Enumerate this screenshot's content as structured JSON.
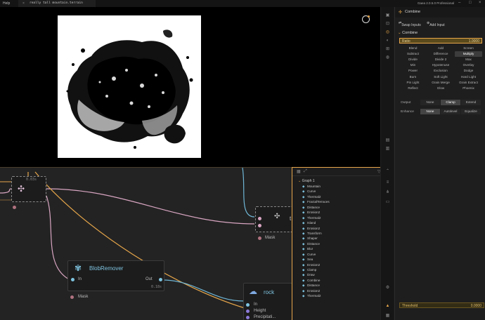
{
  "topbar": {
    "help": "Help",
    "file_close": "×",
    "file_name": "really tall mountain.terrain",
    "product": "Gaea 2.0.5.0 Professional",
    "minimize": "–",
    "maximize": "□",
    "close": "×"
  },
  "colors": {
    "accent": "#e6a64a",
    "node_title": "#7fc4e0",
    "wire_pink": "#d9a6c2",
    "wire_orange": "#e6a64a",
    "wire_blue": "#6fb6d6"
  },
  "graph": {
    "top_node": {
      "timing": "0.03s"
    },
    "blob": {
      "title": "BlobRemover",
      "in": "In",
      "out": "Out",
      "timing": "0.18s",
      "mask": "Mask"
    },
    "right_node": {
      "title": "t",
      "mask": "Mask"
    },
    "rock": {
      "title": "rock",
      "in": "In",
      "height": "Height",
      "precip": "Precipitati..."
    }
  },
  "nodelist": {
    "root": "Graph 1",
    "items": [
      {
        "name": "Mountain",
        "icon": "mountain-icon"
      },
      {
        "name": "Curve",
        "icon": "curve-icon"
      },
      {
        "name": "Thermal2",
        "icon": "thermal-icon"
      },
      {
        "name": "FractalTerraces",
        "icon": "terraces-icon"
      },
      {
        "name": "Distance",
        "icon": "distance-icon"
      },
      {
        "name": "Erosion2",
        "icon": "erosion-icon"
      },
      {
        "name": "Thermal2",
        "icon": "thermal-icon"
      },
      {
        "name": "Island",
        "icon": "island-icon"
      },
      {
        "name": "Erosion2",
        "icon": "erosion-icon"
      },
      {
        "name": "Transform",
        "icon": "transform-icon"
      },
      {
        "name": "Shaper",
        "icon": "shaper-icon"
      },
      {
        "name": "Distance",
        "icon": "distance-icon"
      },
      {
        "name": "Blur",
        "icon": "blur-icon"
      },
      {
        "name": "Curve",
        "icon": "curve-icon"
      },
      {
        "name": "Sea",
        "icon": "sea-icon"
      },
      {
        "name": "Erosion2",
        "icon": "erosion-icon"
      },
      {
        "name": "Clamp",
        "icon": "clamp-icon"
      },
      {
        "name": "Draw",
        "icon": "draw-icon"
      },
      {
        "name": "Combine",
        "icon": "combine-icon"
      },
      {
        "name": "Distance",
        "icon": "distance-icon"
      },
      {
        "name": "Erosion2",
        "icon": "erosion-icon"
      },
      {
        "name": "Thermal2",
        "icon": "thermal-icon"
      }
    ]
  },
  "props": {
    "title": "Combine",
    "swap_inputs": "Swap Inputs",
    "add_input": "Add Input",
    "section": "Combine",
    "ratio_label": "Ratio",
    "ratio_value": "1.0000",
    "modes": [
      "Blend",
      "Add",
      "Screen",
      "Subtract",
      "Difference",
      "Multiply",
      "Divide",
      "Divide 2",
      "Max",
      "Min",
      "Hypotenuse",
      "Overlay",
      "Power",
      "Exclusion",
      "Dodge",
      "Burn",
      "Soft Light",
      "Hard Light",
      "Pin Light",
      "Grain Merge",
      "Grain Extract",
      "Reflect",
      "Glow",
      "Phoenix"
    ],
    "selected_mode": "Multiply",
    "output_label": "Output",
    "output_options": [
      "None",
      "Clamp",
      "Extend"
    ],
    "output_selected": "Clamp",
    "enhance_label": "Enhance",
    "enhance_options": [
      "None",
      "Autolevel",
      "Equalize"
    ],
    "enhance_selected": "None",
    "threshold_label": "Threshold",
    "threshold_value": "0.0000"
  }
}
